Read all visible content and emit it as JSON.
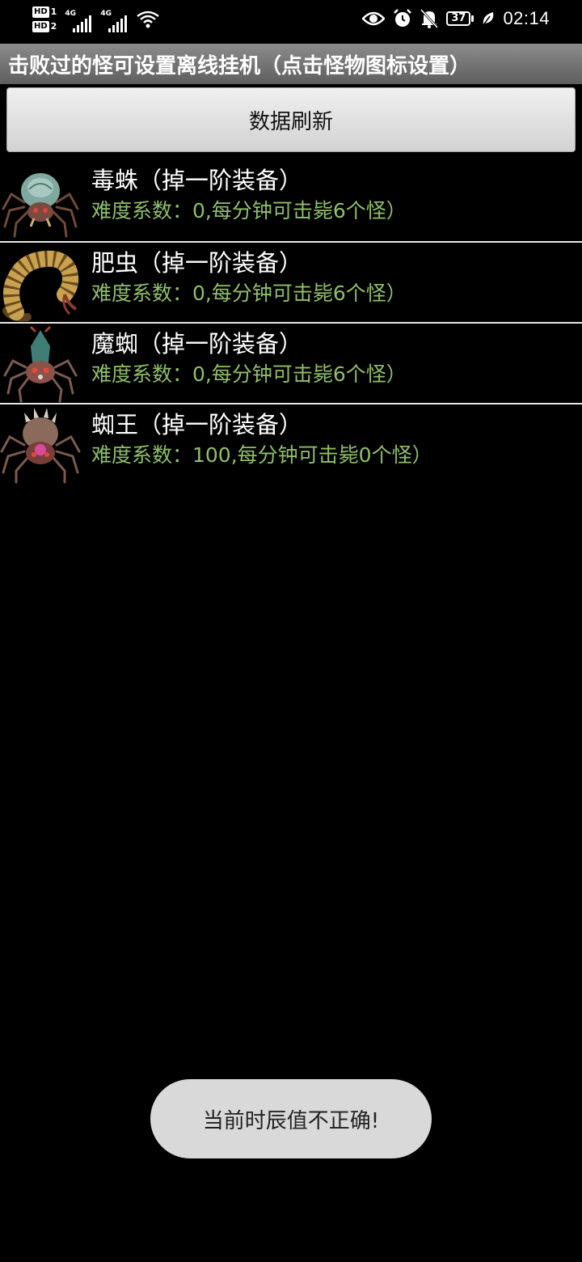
{
  "status_bar": {
    "sim1_badge": "HD",
    "sim1_num": "1",
    "sim2_badge": "HD",
    "sim2_num": "2",
    "signal1_tag": "4G",
    "signal2_tag": "4G",
    "icons": [
      "eye-icon",
      "alarm-icon",
      "bell-muted-icon",
      "battery-icon",
      "leaf-icon"
    ],
    "battery": "37",
    "time": "02:14"
  },
  "app": {
    "title": "击败过的怪可设置离线挂机（点击怪物图标设置）",
    "refresh_label": "数据刷新"
  },
  "monsters": [
    {
      "name": "毒蛛（掉一阶装备）",
      "info": "难度系数：0,每分钟可击毙6个怪）",
      "icon": "poison-spider-icon"
    },
    {
      "name": "肥虫（掉一阶装备）",
      "info": "难度系数：0,每分钟可击毙6个怪）",
      "icon": "fat-worm-icon"
    },
    {
      "name": "魔蜘（掉一阶装备）",
      "info": "难度系数：0,每分钟可击毙6个怪）",
      "icon": "demon-spider-icon"
    },
    {
      "name": "蜘王（掉一阶装备）",
      "info": "难度系数：100,每分钟可击毙0个怪）",
      "icon": "spider-king-icon"
    }
  ],
  "toast": {
    "message": "当前时辰值不正确!"
  },
  "colors": {
    "background": "#000000",
    "info_text": "#8fbf6a",
    "title_bar": "#7a7a7a",
    "toast_bg": "#d9d9d9"
  }
}
